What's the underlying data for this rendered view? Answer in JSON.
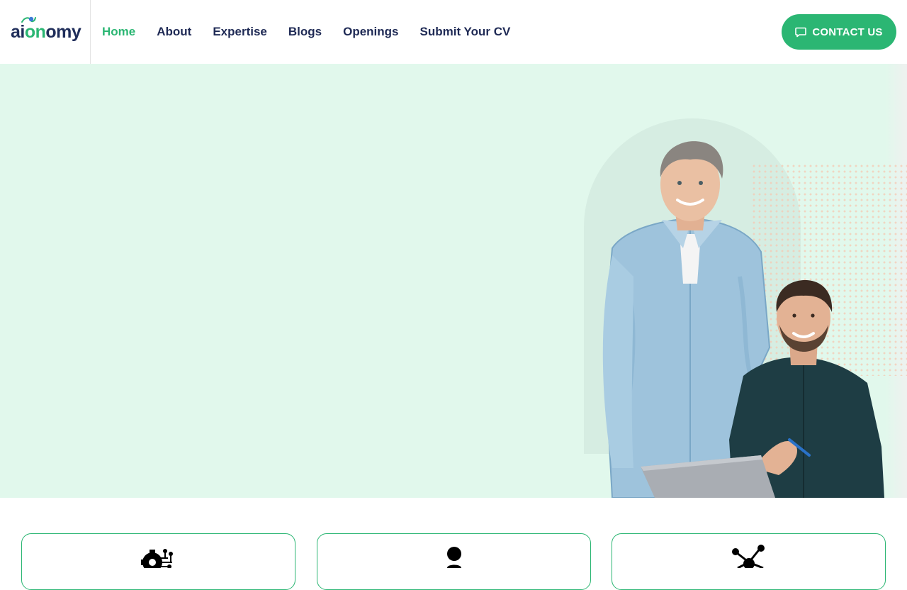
{
  "brand": {
    "logo_text_start": "ai",
    "logo_text_accent": "on",
    "logo_text_end": "omy"
  },
  "nav": {
    "items": [
      {
        "label": "Home",
        "active": true
      },
      {
        "label": "About",
        "active": false
      },
      {
        "label": "Expertise",
        "active": false
      },
      {
        "label": "Blogs",
        "active": false
      },
      {
        "label": "Openings",
        "active": false
      },
      {
        "label": "Submit Your CV",
        "active": false
      }
    ]
  },
  "header": {
    "contact_label": "CONTACT US",
    "contact_icon": "chat-icon"
  },
  "hero": {
    "image": "two-smiling-men-at-laptop"
  },
  "cards": [
    {
      "icon": "gear-circuit-icon"
    },
    {
      "icon": "person-icon"
    },
    {
      "icon": "network-nodes-icon"
    }
  ],
  "colors": {
    "accent": "#2bb673",
    "navy": "#1f2a55",
    "hero_bg": "#e1f8ec"
  }
}
